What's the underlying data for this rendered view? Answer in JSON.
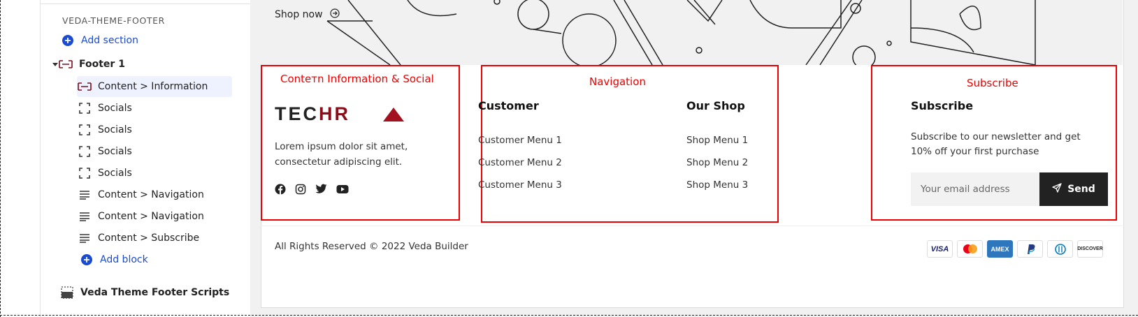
{
  "sidebar": {
    "group_heading": "VEDA-THEME-FOOTER",
    "add_section": "Add section",
    "footer_item": "Footer 1",
    "blocks": [
      {
        "label": "Content > Information",
        "icon": "content-block-icon"
      },
      {
        "label": "Socials",
        "icon": "frame-icon"
      },
      {
        "label": "Socials",
        "icon": "frame-icon"
      },
      {
        "label": "Socials",
        "icon": "frame-icon"
      },
      {
        "label": "Socials",
        "icon": "frame-icon"
      },
      {
        "label": "Content > Navigation",
        "icon": "lines-icon"
      },
      {
        "label": "Content > Navigation",
        "icon": "lines-icon"
      },
      {
        "label": "Content > Subscribe",
        "icon": "lines-icon"
      }
    ],
    "add_block": "Add block",
    "scripts_item": "Veda Theme Footer Scripts",
    "accent": "#1a4bd0"
  },
  "hero": {
    "shop_now": "Shop now"
  },
  "annotations": {
    "info": "Conteтn Information & Social",
    "nav": "Navigation",
    "subscribe": "Subscribe",
    "color": "#e00000"
  },
  "footer": {
    "logo_part1": "TEC",
    "logo_part2": "HR",
    "description": "Lorem ipsum dolor sit amet, consectetur adipiscing elit.",
    "socials": [
      "facebook-icon",
      "instagram-icon",
      "twitter-icon",
      "youtube-icon"
    ],
    "customer": {
      "title": "Customer",
      "links": [
        "Customer Menu 1",
        "Customer Menu 2",
        "Customer Menu 3"
      ]
    },
    "shop": {
      "title": "Our Shop",
      "links": [
        "Shop Menu 1",
        "Shop Menu 2",
        "Shop Menu 3"
      ]
    },
    "subscribe": {
      "title": "Subscribe",
      "text": "Subscribe to our newsletter and get 10% off your first purchase",
      "email_placeholder": "Your email address",
      "send_label": "Send"
    },
    "copyright": "All Rights Reserved © 2022 Veda Builder",
    "payments": [
      "VISA",
      "mastercard",
      "AMEX",
      "PayPal",
      "Diners",
      "DISCOVER"
    ]
  }
}
